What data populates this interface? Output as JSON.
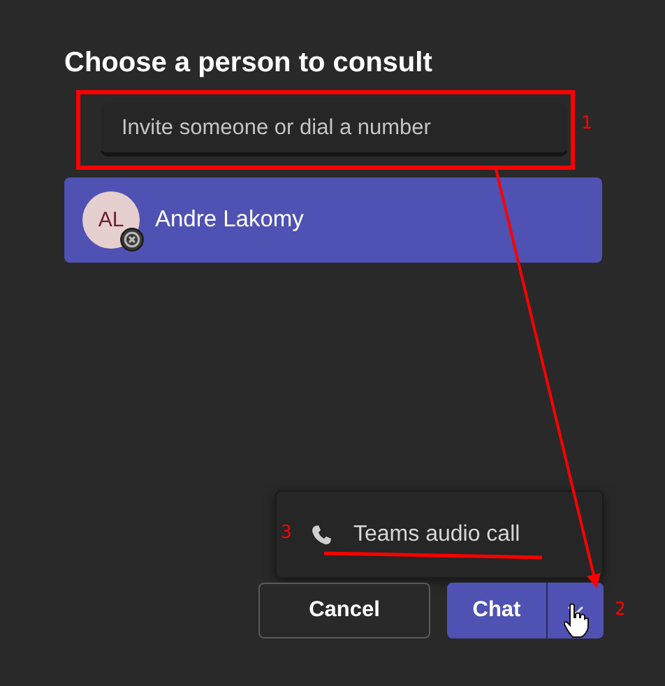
{
  "dialog": {
    "title": "Choose a person to consult"
  },
  "search": {
    "placeholder": "Invite someone or dial a number"
  },
  "people": [
    {
      "initials": "AL",
      "name": "Andre Lakomy"
    }
  ],
  "menu": {
    "items": [
      {
        "label": "Teams audio call"
      }
    ]
  },
  "buttons": {
    "cancel": "Cancel",
    "chat": "Chat"
  },
  "annotations": [
    {
      "label": "1"
    },
    {
      "label": "2"
    },
    {
      "label": "3"
    }
  ]
}
